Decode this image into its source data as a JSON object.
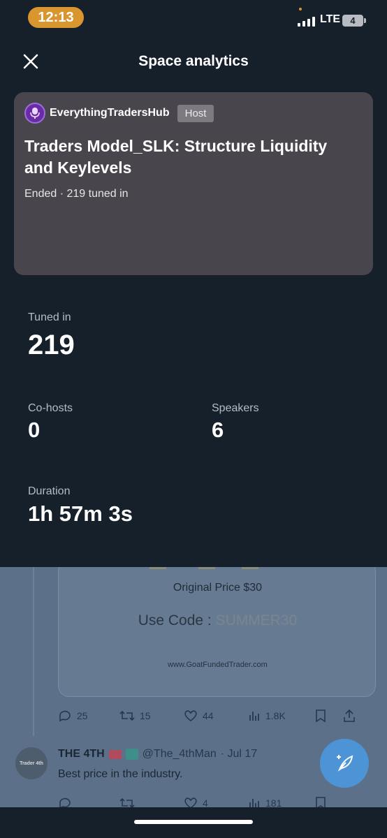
{
  "status_bar": {
    "time": "12:13",
    "network": "LTE",
    "battery": "4"
  },
  "header": {
    "title": "Space analytics",
    "close_icon": "close-icon"
  },
  "space_card": {
    "host_name": "EverythingTradersHub",
    "host_badge": "Host",
    "title": "Traders Model_SLK: Structure Liquidity and Keylevels",
    "meta": "Ended · 219 tuned in"
  },
  "stats": {
    "tuned_in": {
      "label": "Tuned in",
      "value": "219"
    },
    "cohosts": {
      "label": "Co-hosts",
      "value": "0"
    },
    "speakers": {
      "label": "Speakers",
      "value": "6"
    },
    "duration": {
      "label": "Duration",
      "value": "1h 57m 3s"
    }
  },
  "background_timeline": {
    "promo": {
      "original_price": "Original Price $30",
      "use_code_label": "Use Code :",
      "code": "SUMMER30",
      "url": "www.GoatFundedTrader.com"
    },
    "tweet1_actions": {
      "replies": "25",
      "retweets": "15",
      "likes": "44",
      "views": "1.8K"
    },
    "tweet2": {
      "name": "THE 4TH",
      "handle": "@The_4thMan",
      "date": "· Jul 17",
      "text": "Best price in the industry.",
      "avatar_text": "Trader 4th"
    },
    "tweet2_actions": {
      "replies": "",
      "retweets": "",
      "likes": "4",
      "views": "181"
    }
  },
  "colors": {
    "background": "#15202b",
    "card": "#48454d",
    "time_pill": "#d9962f",
    "fab": "#4d94d6"
  }
}
